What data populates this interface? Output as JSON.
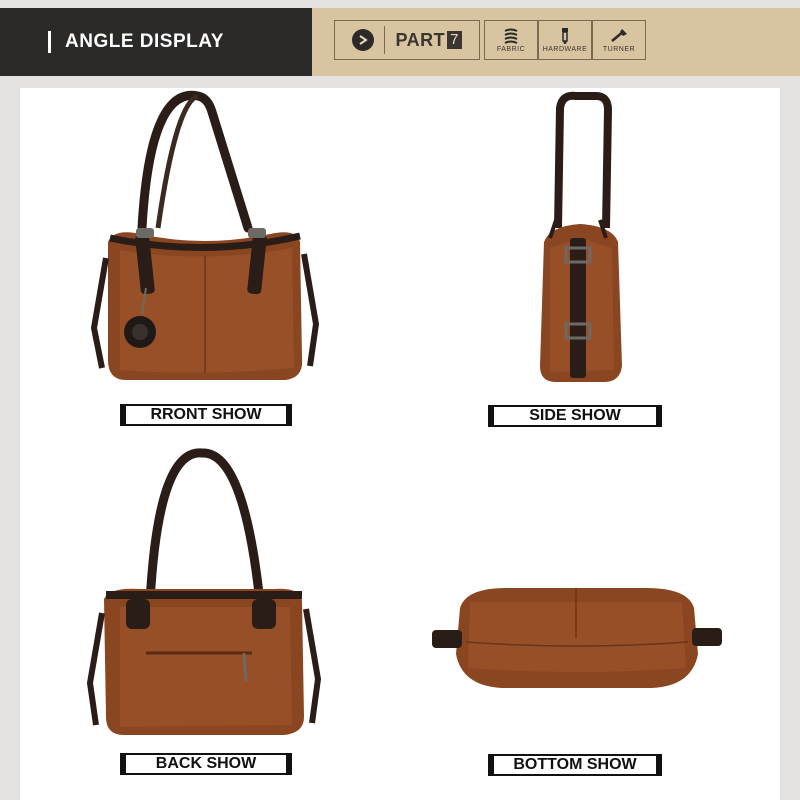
{
  "header": {
    "title": "ANGLE DISPLAY",
    "part_label": "PART",
    "part_number": "7",
    "features": [
      {
        "label": "FABRIC",
        "icon": "fabric-icon"
      },
      {
        "label": "HARDWARE",
        "icon": "zipper-icon"
      },
      {
        "label": "TURNER",
        "icon": "brush-icon"
      }
    ]
  },
  "views": [
    {
      "label": "RRONT SHOW"
    },
    {
      "label": "SIDE SHOW"
    },
    {
      "label": "BACK SHOW"
    },
    {
      "label": "BOTTOM SHOW"
    }
  ],
  "colors": {
    "leather": "#8a4521",
    "leather_light": "#a35a30",
    "strap": "#2a1d17",
    "header_dark": "#2b2a28",
    "header_tan": "#d8c4a0"
  }
}
